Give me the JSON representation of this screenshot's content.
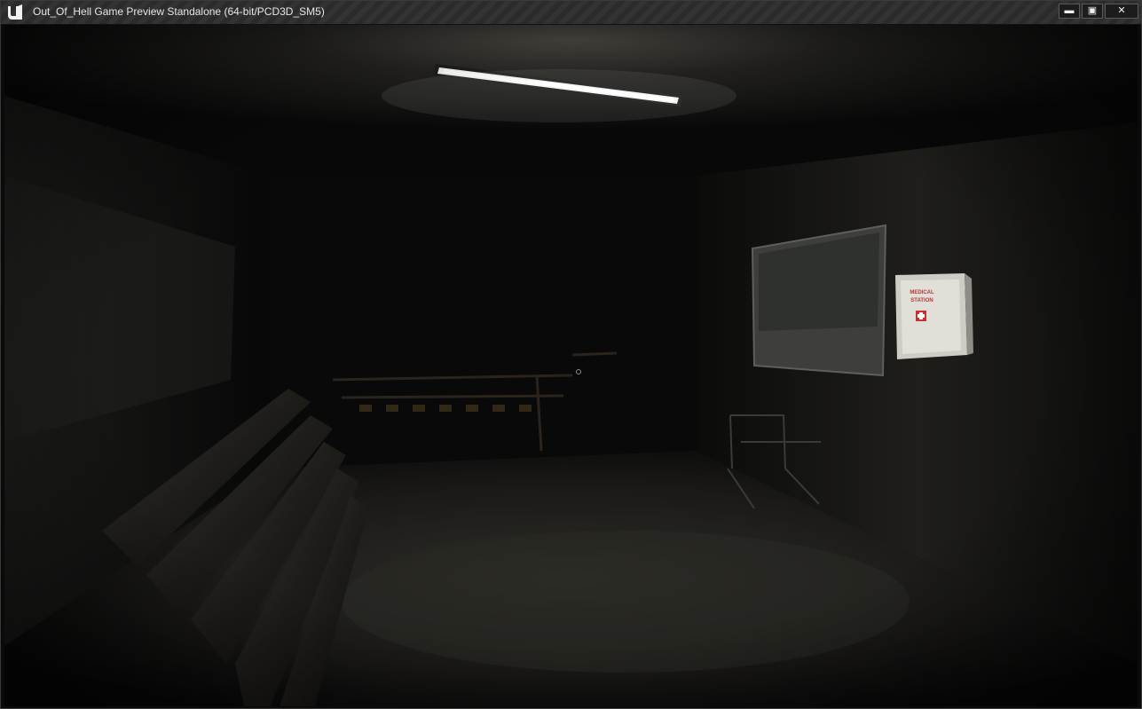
{
  "window": {
    "title": "Out_Of_Hell Game Preview Standalone (64-bit/PCD3D_SM5)",
    "controls": {
      "minimize": "▬",
      "maximize": "▣",
      "close": "✕"
    },
    "logo": "unreal-engine-logo"
  },
  "scene": {
    "sign": {
      "line1": "MEDICAL",
      "line2": "STATION"
    },
    "crosshair": "crosshair-reticle",
    "colors": {
      "ambient": "#050505",
      "light": "#ffffff",
      "sign_red": "#b23a3a"
    }
  }
}
